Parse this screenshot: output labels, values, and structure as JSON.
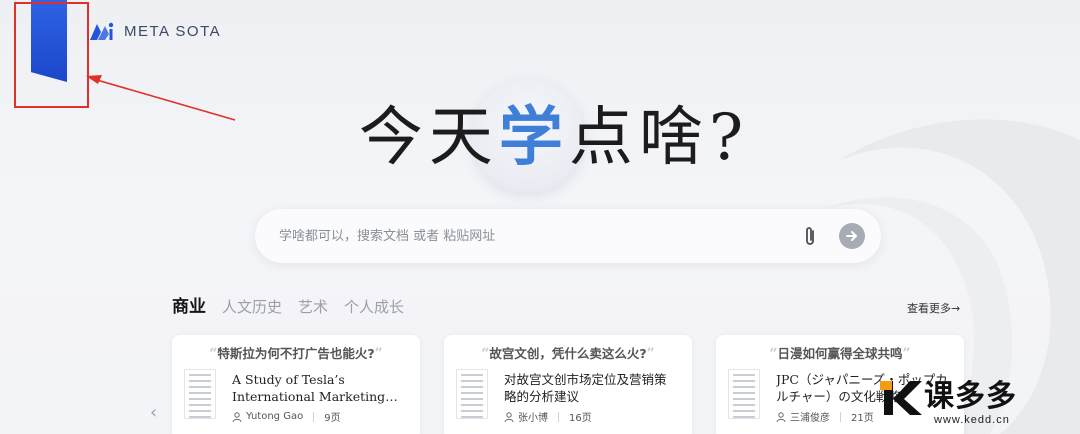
{
  "logo": {
    "text": "META SOTA"
  },
  "hero": {
    "before": "今天",
    "accent": "学",
    "after": "点啥?"
  },
  "search": {
    "placeholder": "学啥都可以，搜索文档 或者 粘贴网址"
  },
  "tabs": [
    {
      "label": "商业",
      "active": true
    },
    {
      "label": "人文历史",
      "active": false
    },
    {
      "label": "艺术",
      "active": false
    },
    {
      "label": "个人成长",
      "active": false
    }
  ],
  "more_label": "查看更多→",
  "cards": [
    {
      "question": "特斯拉为何不打广告也能火?",
      "title": "A Study of Tesla’s International Marketing Strategy",
      "author": "Yutong Gao",
      "pages": "9页"
    },
    {
      "question": "故宫文创，凭什么卖这么火?",
      "title": "对故宫文创市场定位及营销策略的分析建议",
      "author": "张小博",
      "pages": "16页"
    },
    {
      "question": "日漫如何赢得全球共鸣",
      "title": "JPC（ジャパニーズ・ポップカルチャー）の文化戦略",
      "author": "三浦俊彦",
      "pages": "21页"
    }
  ],
  "watermark": {
    "text": "课多多",
    "url": "www.kedd.cn"
  },
  "colors": {
    "accent": "#3f7fd8",
    "bookmark": "#2355d8",
    "annotation": "#e0302a"
  }
}
